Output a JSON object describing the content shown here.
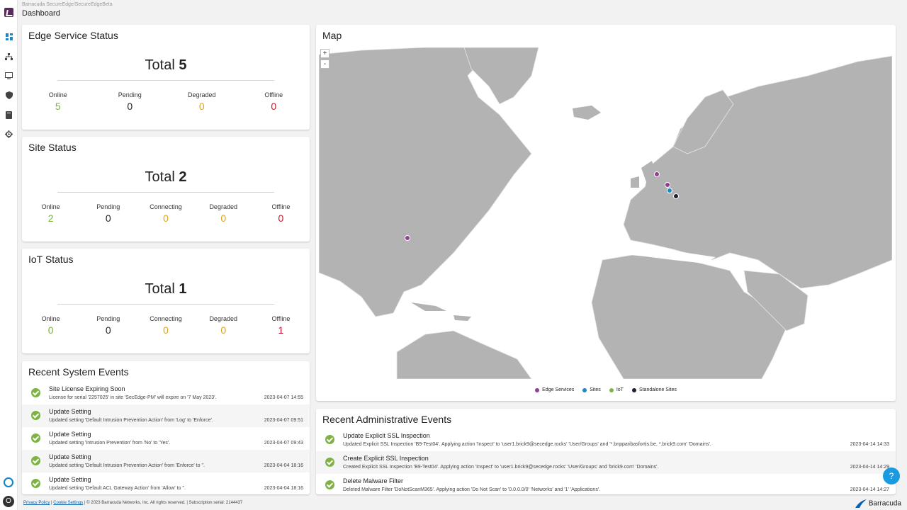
{
  "header": {
    "breadcrumb": "Barracuda SecureEdge/SecureEdgeBeta",
    "title": "Dashboard"
  },
  "nav_icons": [
    "dashboard-icon",
    "network-icon",
    "monitor-icon",
    "shield-icon",
    "book-icon",
    "settings-icon"
  ],
  "edge_service": {
    "title": "Edge Service Status",
    "total_label": "Total",
    "total": "5",
    "stats": [
      {
        "label": "Online",
        "value": "5"
      },
      {
        "label": "Pending",
        "value": "0"
      },
      {
        "label": "Degraded",
        "value": "0"
      },
      {
        "label": "Offline",
        "value": "0"
      }
    ]
  },
  "site_status": {
    "title": "Site Status",
    "total_label": "Total",
    "total": "2",
    "stats": [
      {
        "label": "Online",
        "value": "2"
      },
      {
        "label": "Pending",
        "value": "0"
      },
      {
        "label": "Connecting",
        "value": "0"
      },
      {
        "label": "Degraded",
        "value": "0"
      },
      {
        "label": "Offline",
        "value": "0"
      }
    ]
  },
  "iot_status": {
    "title": "IoT Status",
    "total_label": "Total",
    "total": "1",
    "stats": [
      {
        "label": "Online",
        "value": "0"
      },
      {
        "label": "Pending",
        "value": "0"
      },
      {
        "label": "Connecting",
        "value": "0"
      },
      {
        "label": "Degraded",
        "value": "0"
      },
      {
        "label": "Offline",
        "value": "1"
      }
    ]
  },
  "system_events": {
    "title": "Recent System Events",
    "items": [
      {
        "title": "Site License Expiring Soon",
        "desc": "License for serial '2257025' in site 'SecEdge-PM' will expire on '7 May 2023'.",
        "time": "2023-04-07 14:55"
      },
      {
        "title": "Update Setting",
        "desc": "Updated setting 'Default Intrusion Prevention Action' from 'Log' to 'Enforce'.",
        "time": "2023-04-07 09:51"
      },
      {
        "title": "Update Setting",
        "desc": "Updated setting 'Intrusion Prevention' from 'No' to 'Yes'.",
        "time": "2023-04-07 09:43"
      },
      {
        "title": "Update Setting",
        "desc": "Updated setting 'Default Intrusion Prevention Action' from 'Enforce' to ''.",
        "time": "2023-04-04 18:16"
      },
      {
        "title": "Update Setting",
        "desc": "Updated setting 'Default ACL Gateway Action' from 'Allow' to ''.",
        "time": "2023-04-04 18:16"
      }
    ]
  },
  "map": {
    "title": "Map",
    "zoom_in": "+",
    "zoom_out": "-",
    "legend": [
      {
        "name": "Edge Services",
        "color": "#8e3f8f"
      },
      {
        "name": "Sites",
        "color": "#1b87c4"
      },
      {
        "name": "IoT",
        "color": "#7cb342"
      },
      {
        "name": "Standalone Sites",
        "color": "#1f1f33"
      }
    ]
  },
  "admin_events": {
    "title": "Recent Administrative Events",
    "items": [
      {
        "title": "Update Explicit SSL Inspection",
        "desc": "Updated Explicit SSL Inspection 'B9-Test04'. Applying action 'Inspect' to 'user1.brick9@secedge.rocks' 'User/Groups' and '*.bnpparibasfortis.be, *.brick9.com' 'Domains'.",
        "time": "2023-04-14 14:33"
      },
      {
        "title": "Create Explicit SSL Inspection",
        "desc": "Created Explicit SSL Inspection 'B9-Test04'. Applying action 'Inspect' to 'user1.brick9@secedge.rocks' 'User/Groups' and 'brick9.com' 'Domains'.",
        "time": "2023-04-14 14:29"
      },
      {
        "title": "Delete Malware Filter",
        "desc": "Deleted Malware Filter 'DoNotScanM365'. Applying action 'Do Not Scan' to '0.0.0.0/0' 'Networks' and '1' 'Applications'.",
        "time": "2023-04-14 14:27"
      }
    ]
  },
  "footer": {
    "privacy": "Privacy Policy",
    "sep": " | ",
    "cookie": "Cookie Settings",
    "rest": " | © 2023 Barracuda Networks, Inc. All rights reserved. | Subscription serial: 2144437"
  },
  "brand": "Barracuda",
  "avatar": "O",
  "help": "?",
  "colors": {
    "online": "#7cb342",
    "warning": "#e0a21c",
    "offline": "#c0182f",
    "neutral": "#222222"
  }
}
